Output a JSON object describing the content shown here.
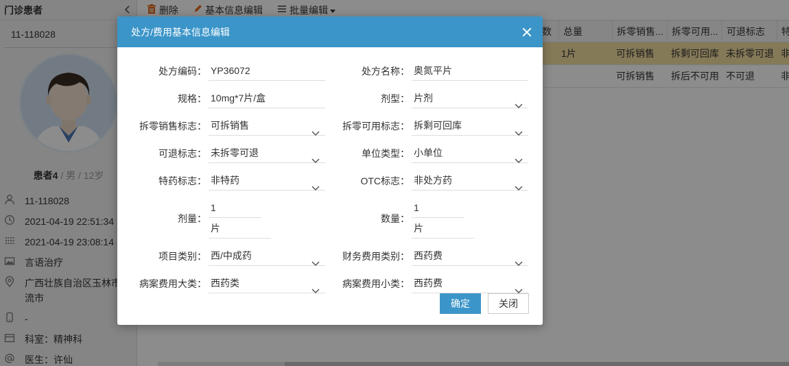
{
  "sidebar": {
    "title": "门诊患者",
    "patient_id": "11-118028",
    "patient_name": "患者4",
    "gender": "男",
    "age": "12岁",
    "info": [
      {
        "icon": "user-icon",
        "text": "11-118028"
      },
      {
        "icon": "clock-icon",
        "text": "2021-04-19 22:51:34"
      },
      {
        "icon": "calendar-icon",
        "text": "2021-04-19 23:08:14"
      },
      {
        "icon": "image-icon",
        "text": "言语治疗"
      },
      {
        "icon": "location-icon",
        "text": "广西壮族自治区玉林市流市"
      },
      {
        "icon": "phone-icon",
        "text": "-"
      },
      {
        "icon": "department-icon",
        "text": "科室：精神科"
      },
      {
        "icon": "at-icon",
        "text": "医生：许仙"
      }
    ]
  },
  "toolbar": {
    "delete_label": "删除",
    "edit_label": "基本信息编辑",
    "batch_label": "批量编辑"
  },
  "grid": {
    "headers": [
      "数",
      "总量",
      "拆零销售...",
      "拆零可用...",
      "可退标志",
      "特"
    ],
    "rows": [
      [
        "",
        "1片",
        "可拆销售",
        "拆剩可回库",
        "未拆零可退",
        "非"
      ],
      [
        "",
        "",
        "可拆销售",
        "拆后不可用",
        "不可退",
        "非"
      ]
    ]
  },
  "modal": {
    "title": "处方/费用基本信息编辑",
    "fields": {
      "code_label": "处方编码：",
      "code_value": "YP36072",
      "name_label": "处方名称：",
      "name_value": "奥氮平片",
      "spec_label": "规格：",
      "spec_value": "10mg*7片/盒",
      "form_label": "剂型：",
      "form_value": "片剂",
      "split_sale_label": "拆零销售标志：",
      "split_sale_value": "可拆销售",
      "split_use_label": "拆零可用标志：",
      "split_use_value": "拆剩可回库",
      "refund_label": "可退标志：",
      "refund_value": "未拆零可退",
      "unit_type_label": "单位类型：",
      "unit_type_value": "小单位",
      "special_label": "特药标志：",
      "special_value": "非特药",
      "otc_label": "OTC标志：",
      "otc_value": "非处方药",
      "dose_label": "剂量：",
      "dose_value": "1",
      "dose_unit": "片",
      "qty_label": "数量：",
      "qty_value": "1",
      "qty_unit": "片",
      "item_cat_label": "项目类别：",
      "item_cat_value": "西/中成药",
      "fin_cat_label": "财务费用类别：",
      "fin_cat_value": "西药费",
      "case_major_label": "病案费用大类：",
      "case_major_value": "西药类",
      "case_minor_label": "病案费用小类：",
      "case_minor_value": "西药费"
    },
    "ok_label": "确定",
    "close_label": "关闭"
  }
}
